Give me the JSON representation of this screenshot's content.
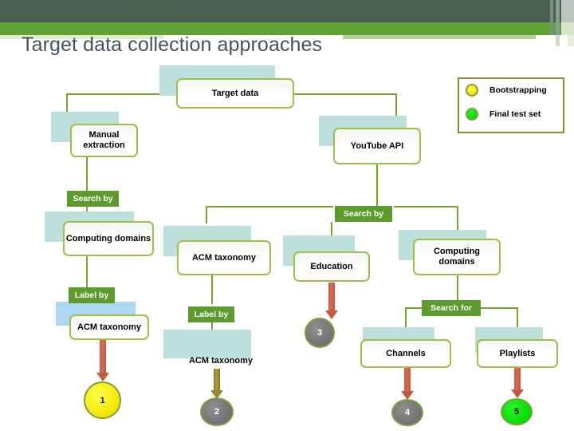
{
  "slide": {
    "title": "Target data collection approaches"
  },
  "legend": {
    "items": [
      {
        "label": "Bootstrapping",
        "color": "#f2e400",
        "icon": "yellow-circle-icon"
      },
      {
        "label": "Final test set",
        "color": "#00e000",
        "icon": "green-circle-icon"
      }
    ]
  },
  "diagram": {
    "type": "flowchart",
    "root": {
      "label": "Target data"
    },
    "branches": [
      {
        "id": "manual",
        "label": "Manual extraction",
        "connector_label": "Search by",
        "children": [
          {
            "label": "Computing domains",
            "connector_label": "Label by",
            "children": [
              {
                "label": "ACM taxonomy",
                "arrow": "red",
                "result": {
                  "number": "1",
                  "color": "yellow"
                }
              }
            ]
          }
        ]
      },
      {
        "id": "youtube",
        "label": "YouTube API",
        "connector_label": "Search by",
        "children": [
          {
            "label": "ACM taxonomy",
            "connector_label": "Label by",
            "children": [
              {
                "label": "ACM taxonomy",
                "arrow": "olive",
                "result": {
                  "number": "2",
                  "color": "gray"
                }
              }
            ]
          },
          {
            "label": "Education",
            "arrow": "red",
            "result": {
              "number": "3",
              "color": "gray"
            }
          },
          {
            "label": "Computing domains",
            "connector_label": "Search for",
            "children": [
              {
                "label": "Channels",
                "arrow": "red",
                "result": {
                  "number": "4",
                  "color": "gray"
                }
              },
              {
                "label": "Playlists",
                "arrow": "red",
                "result": {
                  "number": "5",
                  "color": "green"
                }
              }
            ]
          }
        ]
      }
    ],
    "nodes": {
      "target_data": "Target data",
      "manual_extraction": "Manual extraction",
      "youtube_api": "YouTube API",
      "search_by_left": "Search by",
      "search_by_right": "Search by",
      "computing_domains_left": "Computing domains",
      "acm_taxonomy_mid": "ACM taxonomy",
      "education": "Education",
      "computing_domains_right": "Computing domains",
      "label_by_left": "Label by",
      "label_by_mid": "Label by",
      "search_for": "Search for",
      "acm_taxonomy_left": "ACM taxonomy",
      "acm_taxonomy_mid2": "ACM taxonomy",
      "channels": "Channels",
      "playlists": "Playlists",
      "num_1": "1",
      "num_2": "2",
      "num_3": "3",
      "num_4": "4",
      "num_5": "5"
    }
  },
  "theme": {
    "band_dark": "#49604e",
    "band_green": "#60a235",
    "box_border": "#9dc04a",
    "tag_bg": "#5e9b2e",
    "shadow": "#bee0dc",
    "title_color": "#44545a"
  }
}
